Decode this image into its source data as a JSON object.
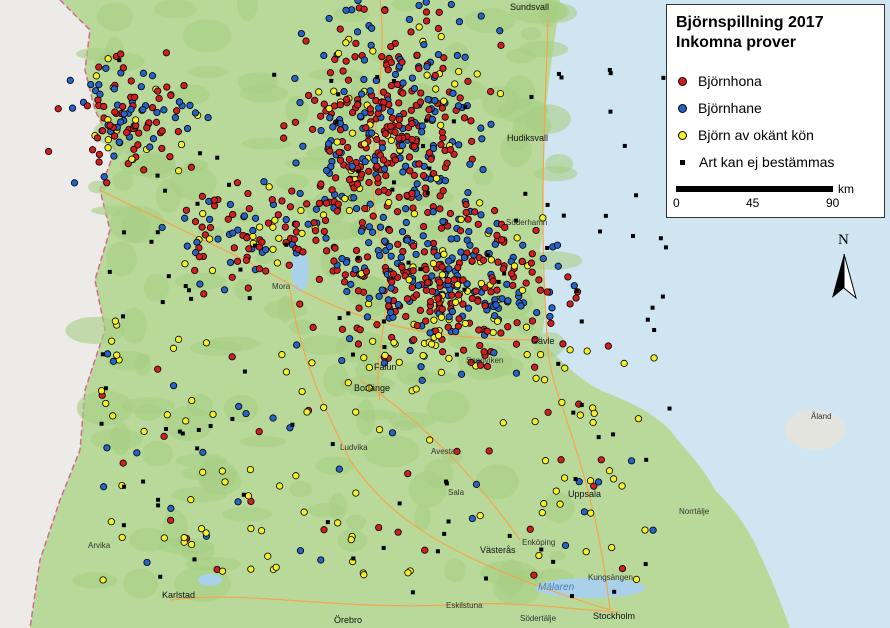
{
  "legend": {
    "title_line1": "Björnspillning 2017",
    "title_line2": "Inkomna prover",
    "items": [
      {
        "label": "Björnhona",
        "color": "#d11e1e",
        "symbol": "dot"
      },
      {
        "label": "Björnhane",
        "color": "#2563c9",
        "symbol": "dot"
      },
      {
        "label": "Björn av okänt kön",
        "color": "#f5ef2a",
        "symbol": "dot"
      },
      {
        "label": "Art kan ej bestämmas",
        "color": "#000000",
        "symbol": "square"
      }
    ]
  },
  "scale": {
    "unit": "km",
    "ticks": [
      "0",
      "45",
      "90"
    ]
  },
  "north_arrow": {
    "label": "N"
  },
  "places": {
    "sundsvall": "Sundsvall",
    "hudiksvall": "Hudiksvall",
    "soderhamn": "Söderhamn",
    "gavle": "Gävle",
    "sandviken": "Sandviken",
    "falun": "Falun",
    "mora": "Mora",
    "borlange": "Borlänge",
    "ludvika": "Ludvika",
    "avesta": "Avesta",
    "uppsala": "Uppsala",
    "vasteras": "Västerås",
    "enkoping": "Enköping",
    "eskilstuna": "Eskilstuna",
    "karlstad": "Karlstad",
    "orebro": "Örebro",
    "stockholm": "Stockholm",
    "malaren": "Mälaren",
    "aland": "Åland",
    "norrtalje": "Norrtälje",
    "arvika": "Arvika",
    "sala": "Sala",
    "kungsangen": "Kungsängen",
    "sodertalje": "Södertälje"
  },
  "colors": {
    "sea": "#cfe6f2",
    "land": "#b9d99a",
    "norway": "#ecebe7",
    "forest": "#a6cf84",
    "lake": "#a9d2ea",
    "road": "#f3a64a",
    "border": "#d46a8e"
  }
}
